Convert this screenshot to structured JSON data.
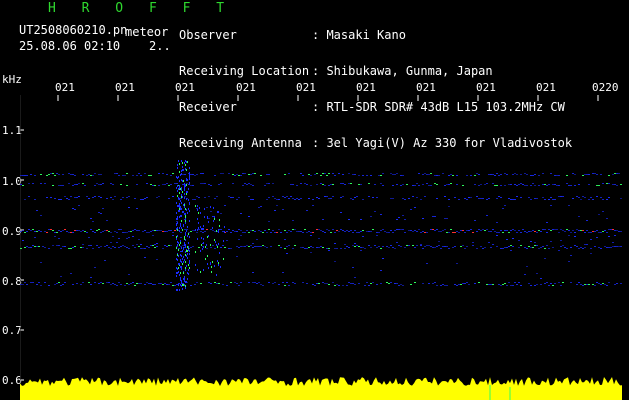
{
  "header": {
    "brand": "H R O F F T",
    "filename": "UT2508060210.pn",
    "tag": "meteor",
    "datetime": "25.08.06 02:10    2..",
    "fields": [
      {
        "label": "Observer",
        "value": "Masaki Kano"
      },
      {
        "label": "Receiving Location",
        "value": "Shibukawa, Gunma, Japan"
      },
      {
        "label": "Receiver",
        "value": "RTL-SDR SDR# 43dB L15 103.2MHz CW"
      },
      {
        "label": "Receiving Antenna",
        "value": "3el Yagi(V) Az 330 for Vladivostok"
      }
    ]
  },
  "spectrogram": {
    "unit_label": "kHz",
    "y_ticks": [
      "1.1",
      "1.0",
      "0.9",
      "0.8",
      "0.7",
      "0.6"
    ],
    "x_ticks": [
      "021",
      "021",
      "021",
      "021",
      "021",
      "021",
      "021",
      "021",
      "021",
      "0220"
    ],
    "colors": {
      "background": "#000000",
      "signal": "#1a2cff",
      "hot": "#ff3030",
      "mid": "#30ff60",
      "amplitude": "#ffff00",
      "grid": "#ffffff"
    }
  }
}
